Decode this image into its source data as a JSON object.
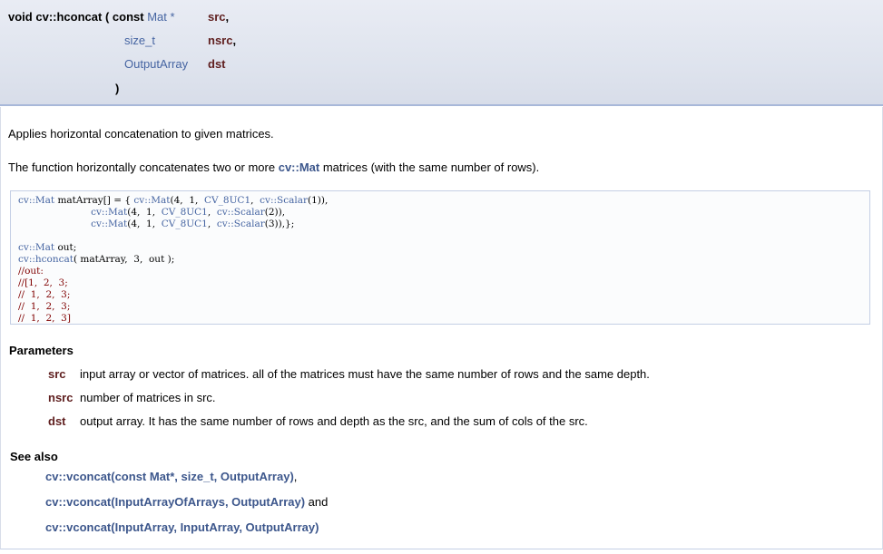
{
  "prototype": {
    "return_type": "void",
    "function_name": "cv::hconcat",
    "open_paren": "(",
    "params": [
      {
        "qualifier": "const",
        "type": "Mat",
        "suffix": " *",
        "name": "src",
        "sep": ","
      },
      {
        "qualifier": "",
        "type": "size_t",
        "suffix": "",
        "name": "nsrc",
        "sep": ","
      },
      {
        "qualifier": "",
        "type": "OutputArray",
        "suffix": "",
        "name": "dst",
        "sep": ""
      }
    ],
    "close_paren": ")"
  },
  "brief": "Applies horizontal concatenation to given matrices.",
  "detail": {
    "before": "The function horizontally concatenates two or more ",
    "link": "cv::Mat",
    "after": " matrices (with the same number of rows)."
  },
  "code": {
    "l1": {
      "a": "cv::Mat",
      "b": " matArray[] = { ",
      "c": "cv::Mat",
      "d": "(4,  1,  ",
      "e": "CV_8UC1",
      "f": ",  ",
      "g": "cv::Scalar",
      "h": "(1)),"
    },
    "l2": {
      "pad": "                        ",
      "c": "cv::Mat",
      "d": "(4,  1,  ",
      "e": "CV_8UC1",
      "f": ",  ",
      "g": "cv::Scalar",
      "h": "(2)),"
    },
    "l3": {
      "pad": "                        ",
      "c": "cv::Mat",
      "d": "(4,  1,  ",
      "e": "CV_8UC1",
      "f": ",  ",
      "g": "cv::Scalar",
      "h": "(3)),};"
    },
    "l5": {
      "a": "cv::Mat",
      "b": " out;"
    },
    "l6": {
      "a": "cv::hconcat",
      "b": "( matArray,  3,  out );"
    },
    "comments": [
      "//out:",
      "//[1,  2,  3;",
      "//  1,  2,  3;",
      "//  1,  2,  3;",
      "//  1,  2,  3]"
    ]
  },
  "parameters": {
    "heading": "Parameters",
    "items": [
      {
        "name": "src",
        "desc": "input array or vector of matrices. all of the matrices must have the same number of rows and the same depth."
      },
      {
        "name": "nsrc",
        "desc": "number of matrices in src."
      },
      {
        "name": "dst",
        "desc": "output array. It has the same number of rows and depth as the src, and the sum of cols of the src."
      }
    ]
  },
  "see_also": {
    "heading": "See also",
    "items": [
      {
        "link": "cv::vconcat(const Mat*, size_t, OutputArray)",
        "after": ","
      },
      {
        "link": "cv::vconcat(InputArrayOfArrays, OutputArray)",
        "after": " and"
      },
      {
        "link": "cv::vconcat(InputArray, InputArray, OutputArray)",
        "after": ""
      }
    ]
  }
}
